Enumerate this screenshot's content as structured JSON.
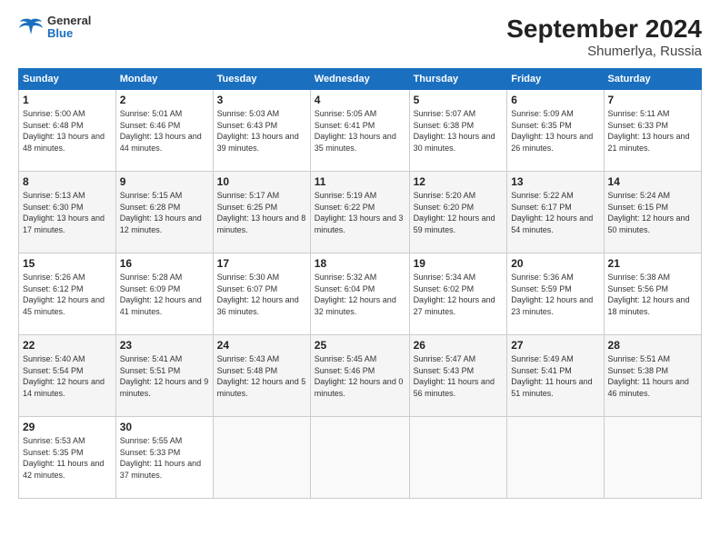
{
  "logo": {
    "line1": "General",
    "line2": "Blue"
  },
  "title": "September 2024",
  "subtitle": "Shumerlya, Russia",
  "days_of_week": [
    "Sunday",
    "Monday",
    "Tuesday",
    "Wednesday",
    "Thursday",
    "Friday",
    "Saturday"
  ],
  "weeks": [
    [
      {
        "day": "1",
        "sunrise": "5:00 AM",
        "sunset": "6:48 PM",
        "daylight": "13 hours and 48 minutes."
      },
      {
        "day": "2",
        "sunrise": "5:01 AM",
        "sunset": "6:46 PM",
        "daylight": "13 hours and 44 minutes."
      },
      {
        "day": "3",
        "sunrise": "5:03 AM",
        "sunset": "6:43 PM",
        "daylight": "13 hours and 39 minutes."
      },
      {
        "day": "4",
        "sunrise": "5:05 AM",
        "sunset": "6:41 PM",
        "daylight": "13 hours and 35 minutes."
      },
      {
        "day": "5",
        "sunrise": "5:07 AM",
        "sunset": "6:38 PM",
        "daylight": "13 hours and 30 minutes."
      },
      {
        "day": "6",
        "sunrise": "5:09 AM",
        "sunset": "6:35 PM",
        "daylight": "13 hours and 26 minutes."
      },
      {
        "day": "7",
        "sunrise": "5:11 AM",
        "sunset": "6:33 PM",
        "daylight": "13 hours and 21 minutes."
      }
    ],
    [
      {
        "day": "8",
        "sunrise": "5:13 AM",
        "sunset": "6:30 PM",
        "daylight": "13 hours and 17 minutes."
      },
      {
        "day": "9",
        "sunrise": "5:15 AM",
        "sunset": "6:28 PM",
        "daylight": "13 hours and 12 minutes."
      },
      {
        "day": "10",
        "sunrise": "5:17 AM",
        "sunset": "6:25 PM",
        "daylight": "13 hours and 8 minutes."
      },
      {
        "day": "11",
        "sunrise": "5:19 AM",
        "sunset": "6:22 PM",
        "daylight": "13 hours and 3 minutes."
      },
      {
        "day": "12",
        "sunrise": "5:20 AM",
        "sunset": "6:20 PM",
        "daylight": "12 hours and 59 minutes."
      },
      {
        "day": "13",
        "sunrise": "5:22 AM",
        "sunset": "6:17 PM",
        "daylight": "12 hours and 54 minutes."
      },
      {
        "day": "14",
        "sunrise": "5:24 AM",
        "sunset": "6:15 PM",
        "daylight": "12 hours and 50 minutes."
      }
    ],
    [
      {
        "day": "15",
        "sunrise": "5:26 AM",
        "sunset": "6:12 PM",
        "daylight": "12 hours and 45 minutes."
      },
      {
        "day": "16",
        "sunrise": "5:28 AM",
        "sunset": "6:09 PM",
        "daylight": "12 hours and 41 minutes."
      },
      {
        "day": "17",
        "sunrise": "5:30 AM",
        "sunset": "6:07 PM",
        "daylight": "12 hours and 36 minutes."
      },
      {
        "day": "18",
        "sunrise": "5:32 AM",
        "sunset": "6:04 PM",
        "daylight": "12 hours and 32 minutes."
      },
      {
        "day": "19",
        "sunrise": "5:34 AM",
        "sunset": "6:02 PM",
        "daylight": "12 hours and 27 minutes."
      },
      {
        "day": "20",
        "sunrise": "5:36 AM",
        "sunset": "5:59 PM",
        "daylight": "12 hours and 23 minutes."
      },
      {
        "day": "21",
        "sunrise": "5:38 AM",
        "sunset": "5:56 PM",
        "daylight": "12 hours and 18 minutes."
      }
    ],
    [
      {
        "day": "22",
        "sunrise": "5:40 AM",
        "sunset": "5:54 PM",
        "daylight": "12 hours and 14 minutes."
      },
      {
        "day": "23",
        "sunrise": "5:41 AM",
        "sunset": "5:51 PM",
        "daylight": "12 hours and 9 minutes."
      },
      {
        "day": "24",
        "sunrise": "5:43 AM",
        "sunset": "5:48 PM",
        "daylight": "12 hours and 5 minutes."
      },
      {
        "day": "25",
        "sunrise": "5:45 AM",
        "sunset": "5:46 PM",
        "daylight": "12 hours and 0 minutes."
      },
      {
        "day": "26",
        "sunrise": "5:47 AM",
        "sunset": "5:43 PM",
        "daylight": "11 hours and 56 minutes."
      },
      {
        "day": "27",
        "sunrise": "5:49 AM",
        "sunset": "5:41 PM",
        "daylight": "11 hours and 51 minutes."
      },
      {
        "day": "28",
        "sunrise": "5:51 AM",
        "sunset": "5:38 PM",
        "daylight": "11 hours and 46 minutes."
      }
    ],
    [
      {
        "day": "29",
        "sunrise": "5:53 AM",
        "sunset": "5:35 PM",
        "daylight": "11 hours and 42 minutes."
      },
      {
        "day": "30",
        "sunrise": "5:55 AM",
        "sunset": "5:33 PM",
        "daylight": "11 hours and 37 minutes."
      },
      null,
      null,
      null,
      null,
      null
    ]
  ],
  "labels": {
    "sunrise": "Sunrise:",
    "sunset": "Sunset:",
    "daylight": "Daylight:"
  }
}
